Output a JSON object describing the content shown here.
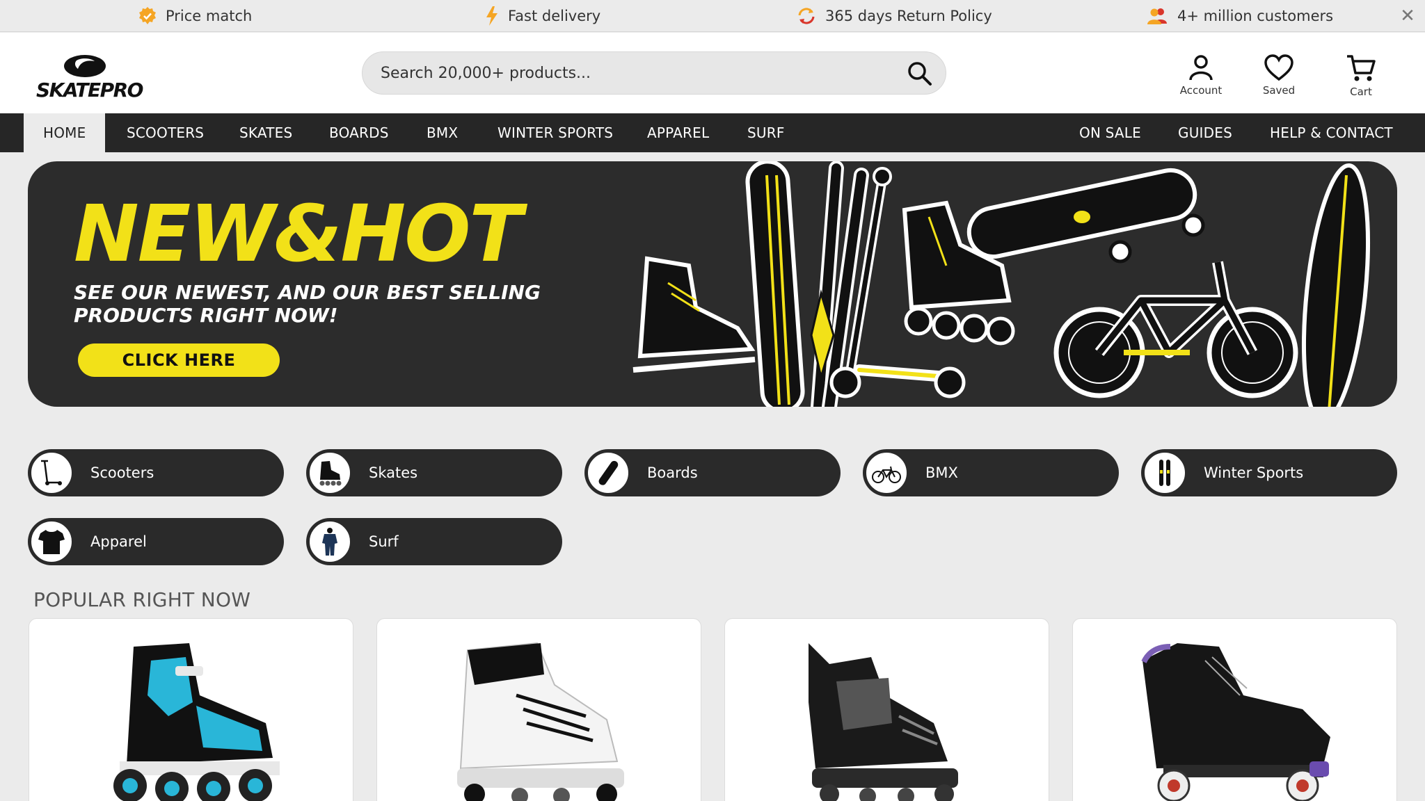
{
  "usp_bar": {
    "items": [
      {
        "icon": "badge-check-icon",
        "label": "Price match"
      },
      {
        "icon": "lightning-icon",
        "label": "Fast delivery"
      },
      {
        "icon": "return-arrows-icon",
        "label": "365 days Return Policy"
      },
      {
        "icon": "customers-icon",
        "label": "4+ million customers"
      }
    ],
    "close_symbol": "✕"
  },
  "header": {
    "logo_text": "SKATEPRO",
    "search_placeholder": "Search 20,000+ products...",
    "actions": [
      {
        "icon": "account-icon",
        "label": "Account"
      },
      {
        "icon": "heart-icon",
        "label": "Saved"
      },
      {
        "icon": "cart-icon",
        "label": "Cart"
      }
    ]
  },
  "nav": {
    "left": [
      "HOME",
      "SCOOTERS",
      "SKATES",
      "BOARDS",
      "BMX",
      "WINTER SPORTS",
      "APPAREL",
      "SURF"
    ],
    "right": [
      "ON SALE",
      "GUIDES",
      "HELP & CONTACT"
    ],
    "active": "HOME"
  },
  "hero": {
    "title": "NEW&HOT",
    "subtitle_line1": "SEE OUR NEWEST, AND OUR BEST SELLING",
    "subtitle_line2": "PRODUCTS RIGHT NOW!",
    "cta": "CLICK HERE",
    "accent_color": "#f2e118"
  },
  "categories": [
    {
      "label": "Scooters",
      "icon": "scooter-icon"
    },
    {
      "label": "Skates",
      "icon": "inline-skate-icon"
    },
    {
      "label": "Boards",
      "icon": "skateboard-icon"
    },
    {
      "label": "BMX",
      "icon": "bmx-bike-icon"
    },
    {
      "label": "Winter Sports",
      "icon": "skis-icon"
    },
    {
      "label": "Apparel",
      "icon": "tshirt-icon"
    },
    {
      "label": "Surf",
      "icon": "wetsuit-icon"
    }
  ],
  "popular": {
    "title": "POPULAR RIGHT NOW",
    "products": [
      {
        "image": "blue-black-inline-skate"
      },
      {
        "image": "white-aggressive-skate"
      },
      {
        "image": "black-aggressive-skate"
      },
      {
        "image": "black-quad-roller-skate"
      }
    ]
  },
  "colors": {
    "nav_bg": "#262626",
    "page_bg": "#ebebeb",
    "accent": "#f2e118"
  }
}
